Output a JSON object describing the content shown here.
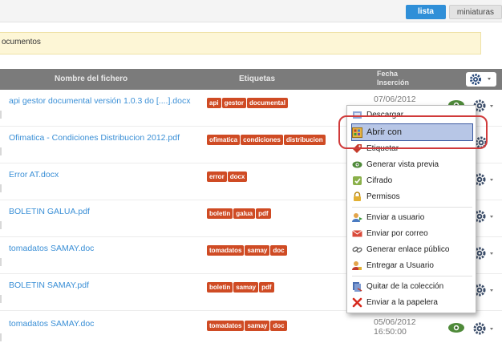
{
  "view_toggle": {
    "list_label": "lista",
    "thumbs_label": "miniaturas"
  },
  "notice": {
    "text": "ocumentos"
  },
  "table": {
    "header": {
      "name": "Nombre del fichero",
      "tags": "Etiquetas",
      "date_line1": "Fecha",
      "date_line2": "Inserción"
    },
    "rows": [
      {
        "name": "api gestor documental versión 1.0.3 do [....].docx",
        "tags": [
          "api",
          "gestor",
          "documental"
        ],
        "date_line1": "07/06/2012",
        "date_line2": ""
      },
      {
        "name": "Ofimatica - Condiciones Distribucion 2012.pdf",
        "tags": [
          "ofimatica",
          "condiciones",
          "distribucion"
        ],
        "date_line1": "",
        "date_line2": ""
      },
      {
        "name": "Error AT.docx",
        "tags": [
          "error",
          "docx"
        ],
        "date_line1": "",
        "date_line2": ""
      },
      {
        "name": "BOLETIN GALUA.pdf",
        "tags": [
          "boletin",
          "galua",
          "pdf"
        ],
        "date_line1": "",
        "date_line2": ""
      },
      {
        "name": "tomadatos SAMAY.doc",
        "tags": [
          "tomadatos",
          "samay",
          "doc"
        ],
        "date_line1": "",
        "date_line2": ""
      },
      {
        "name": "BOLETIN SAMAY.pdf",
        "tags": [
          "boletin",
          "samay",
          "pdf"
        ],
        "date_line1": "",
        "date_line2": ""
      },
      {
        "name": "tomadatos SAMAY.doc",
        "tags": [
          "tomadatos",
          "samay",
          "doc"
        ],
        "date_line1": "05/06/2012",
        "date_line2": "16:50:00"
      }
    ]
  },
  "context_menu": {
    "items": [
      {
        "label": "Descargar",
        "icon": "download-icon"
      },
      {
        "label": "Abrir con",
        "icon": "open-with-icon"
      },
      {
        "label": "Etiquetar",
        "icon": "tag-icon"
      },
      {
        "label": "Generar vista previa",
        "icon": "eye-icon"
      },
      {
        "label": "Cifrado",
        "icon": "encrypt-icon"
      },
      {
        "label": "Permisos",
        "icon": "lock-icon"
      },
      {
        "label": "Enviar a usuario",
        "icon": "send-user-icon"
      },
      {
        "label": "Enviar por correo",
        "icon": "mail-icon"
      },
      {
        "label": "Generar enlace público",
        "icon": "link-icon"
      },
      {
        "label": "Entregar a Usuario",
        "icon": "deliver-icon"
      },
      {
        "label": "Quitar de la colección",
        "icon": "remove-collection-icon"
      },
      {
        "label": "Enviar a la papelera",
        "icon": "trash-icon"
      }
    ]
  },
  "colors": {
    "accent": "#2f8fd8",
    "tag": "#cf4b24",
    "highlight": "#b7c6e6",
    "callout": "#d03a3a"
  }
}
